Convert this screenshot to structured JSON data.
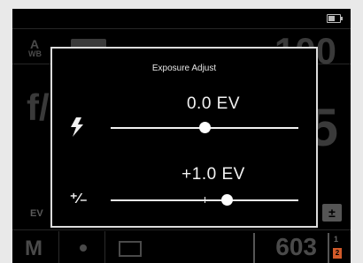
{
  "camera_bg": {
    "wb_top": "A",
    "wb_bottom": "WB",
    "iso_value": "100",
    "aperture": "f/",
    "shutter_digit": "5",
    "ev_label": "EV",
    "mode": "M",
    "shots_remaining": "603",
    "card_slot": "1",
    "card_label": "2"
  },
  "dialog": {
    "title": "Exposure Adjust",
    "flash": {
      "value": "0.0 EV",
      "position_fraction": 0.5,
      "icon": "flash-icon"
    },
    "exposure": {
      "value": "+1.0 EV",
      "position_fraction": 0.62,
      "icon": "plus-minus-icon"
    }
  },
  "colors": {
    "screen_bg": "#000000",
    "dialog_border": "#dcdcdc",
    "text": "#f2f2f2",
    "card_accent": "#d25a2a"
  }
}
